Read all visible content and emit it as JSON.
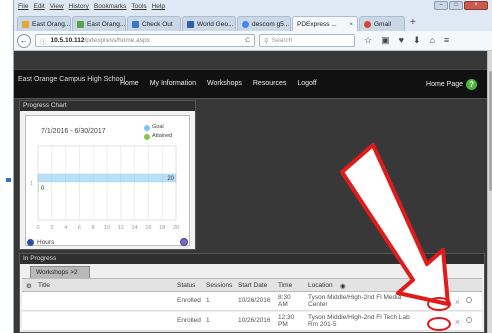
{
  "browser": {
    "menu": [
      "File",
      "Edit",
      "View",
      "History",
      "Bookmarks",
      "Tools",
      "Help"
    ],
    "window_controls": [
      "–",
      "□",
      "×"
    ],
    "tabs": [
      {
        "label": "East Orang...",
        "color": "#e5a832"
      },
      {
        "label": "East Orang...",
        "color": "#59a34b"
      },
      {
        "label": "Check Out",
        "color": "#3a78c8"
      },
      {
        "label": "World Geo...",
        "color": "#2f5da8"
      },
      {
        "label": "descom g5...",
        "color": "#4285f4"
      },
      {
        "label": "PDExpress ...",
        "color": "#e8e8e8",
        "close": "×"
      },
      {
        "label": "Gmail",
        "color": "#d44638"
      }
    ],
    "new_tab": "+",
    "url_host": "10.5.10.112",
    "url_path": "/pdexpress/home.aspx",
    "reload": "C",
    "search_placeholder": "Search",
    "toolbar_icons": [
      "☆",
      "▣",
      "♥",
      "⬇",
      "⌂",
      "≡"
    ]
  },
  "site": {
    "school": "East Orange Campus High School",
    "nav": [
      "Home",
      "My Information",
      "Workshops",
      "Resources",
      "Logoff"
    ],
    "home_page": "Home Page",
    "help": "?"
  },
  "progress": {
    "title": "Progress Chart",
    "date_range": "7/1/2016 - 6/30/2017",
    "legend_goal": "Goal",
    "legend_attained": "Attained",
    "hours_label": "Hours",
    "colors": {
      "goal": "#7fc6ee",
      "attained": "#86c84a"
    }
  },
  "chart_data": {
    "type": "bar",
    "orientation": "horizontal",
    "title": "7/1/2016 - 6/30/2017",
    "xlabel": "Hours",
    "xlim": [
      0,
      20
    ],
    "xticks": [
      "0",
      "2",
      "4",
      "6",
      "8",
      "10",
      "12",
      "14",
      "16",
      "18",
      "20"
    ],
    "categories": [
      "1"
    ],
    "series": [
      {
        "name": "Goal",
        "values": [
          20
        ]
      },
      {
        "name": "Attained",
        "values": [
          0
        ]
      }
    ],
    "data_labels": [
      "20",
      "0"
    ],
    "grid": true,
    "legend": "top-right"
  },
  "inprogress": {
    "title": "In Progress",
    "tab_label": "Workshops >2",
    "columns": {
      "title": "Title",
      "status": "Status",
      "sessions": "Sessions",
      "start_date": "Start Date",
      "time": "Time",
      "location": "Location"
    },
    "rows": [
      {
        "status": "Enrolled",
        "sessions": "1",
        "start_date": "10/26/2016",
        "time": "8:30 AM",
        "location": "Tyson Middle/High-2nd Fl Media Center",
        "drop": "×"
      },
      {
        "status": "Enrolled",
        "sessions": "1",
        "start_date": "10/26/2016",
        "time": "12:30 PM",
        "location": "Tyson Middle/High-2nd Fl Tech Lab Rm 201-5",
        "drop": "×"
      }
    ]
  }
}
